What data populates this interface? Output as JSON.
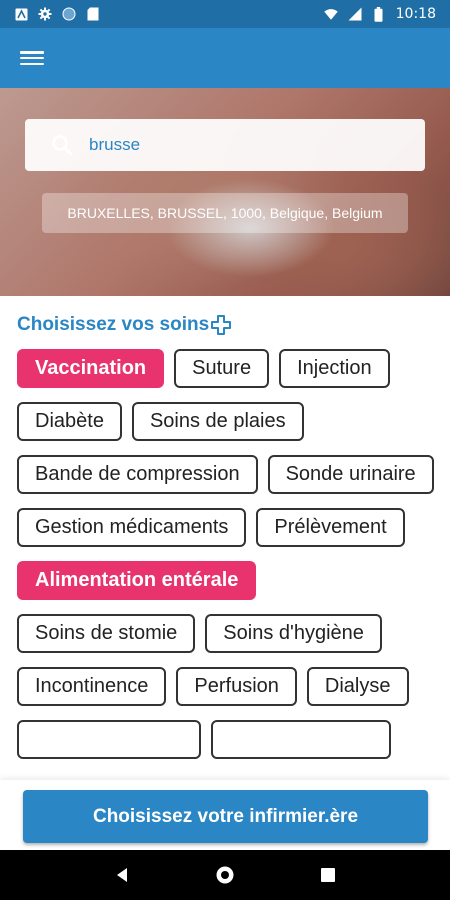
{
  "status_bar": {
    "time": "10:18"
  },
  "search": {
    "value": "brusse"
  },
  "suggestion": {
    "label": "BRUXELLES, BRUSSEL, 1000, Belgique, Belgium"
  },
  "section": {
    "title": "Choisissez vos soins"
  },
  "chips": [
    {
      "label": "Vaccination",
      "selected": true
    },
    {
      "label": "Suture",
      "selected": false
    },
    {
      "label": "Injection",
      "selected": false
    },
    {
      "label": "Diabète",
      "selected": false
    },
    {
      "label": "Soins de plaies",
      "selected": false
    },
    {
      "label": "Bande de compression",
      "selected": false
    },
    {
      "label": "Sonde urinaire",
      "selected": false
    },
    {
      "label": "Gestion médicaments",
      "selected": false
    },
    {
      "label": "Prélèvement",
      "selected": false
    },
    {
      "label": "Alimentation entérale",
      "selected": true
    },
    {
      "label": "Soins de stomie",
      "selected": false
    },
    {
      "label": "Soins d'hygiène",
      "selected": false
    },
    {
      "label": "Incontinence",
      "selected": false
    },
    {
      "label": "Perfusion",
      "selected": false
    },
    {
      "label": "Dialyse",
      "selected": false
    }
  ],
  "cta": {
    "label": "Choisissez votre infirmier.ère"
  },
  "colors": {
    "primary": "#2a86c4",
    "selected": "#e8336e",
    "status_bar": "#1f6fa6"
  }
}
